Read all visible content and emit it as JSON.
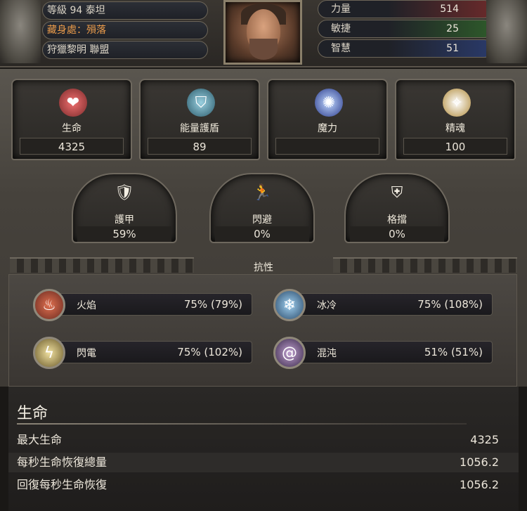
{
  "header": {
    "level_line": "等級 94 泰坦",
    "stash_line": "藏身處：殞落",
    "league_line": "狩獵黎明 聯盟",
    "attributes": [
      {
        "name": "力量",
        "value": "514",
        "color": "#a03a3a"
      },
      {
        "name": "敏捷",
        "value": "25",
        "color": "#3a7a3a"
      },
      {
        "name": "智慧",
        "value": "51",
        "color": "#3a4a9a"
      }
    ]
  },
  "stats": [
    {
      "label": "生命",
      "value": "4325",
      "icon": "heart-icon"
    },
    {
      "label": "能量護盾",
      "value": "89",
      "icon": "energy-shield-icon"
    },
    {
      "label": "魔力",
      "value": "",
      "icon": "mana-icon"
    },
    {
      "label": "精魂",
      "value": "100",
      "icon": "spirit-icon"
    }
  ],
  "defences": [
    {
      "label": "護甲",
      "value": "59%",
      "icon": "armour-icon"
    },
    {
      "label": "閃避",
      "value": "0%",
      "icon": "evasion-icon"
    },
    {
      "label": "格擋",
      "value": "0%",
      "icon": "block-shield-icon"
    }
  ],
  "resistances": {
    "title": "抗性",
    "items": [
      {
        "label": "火焰",
        "value": "75% (79%)",
        "icon": "fire-icon",
        "color": "#b0433a"
      },
      {
        "label": "冰冷",
        "value": "75% (108%)",
        "icon": "cold-icon",
        "color": "#4a7aa0"
      },
      {
        "label": "閃電",
        "value": "75% (102%)",
        "icon": "lightning-icon",
        "color": "#b09a4a"
      },
      {
        "label": "混沌",
        "value": "51% (51%)",
        "icon": "chaos-icon",
        "color": "#7a5a8a"
      }
    ]
  },
  "details": {
    "title": "生命",
    "rows": [
      {
        "key": "最大生命",
        "value": "4325"
      },
      {
        "key": "每秒生命恢復總量",
        "value": "1056.2"
      },
      {
        "key": "回復每秒生命恢復",
        "value": "1056.2"
      }
    ]
  }
}
